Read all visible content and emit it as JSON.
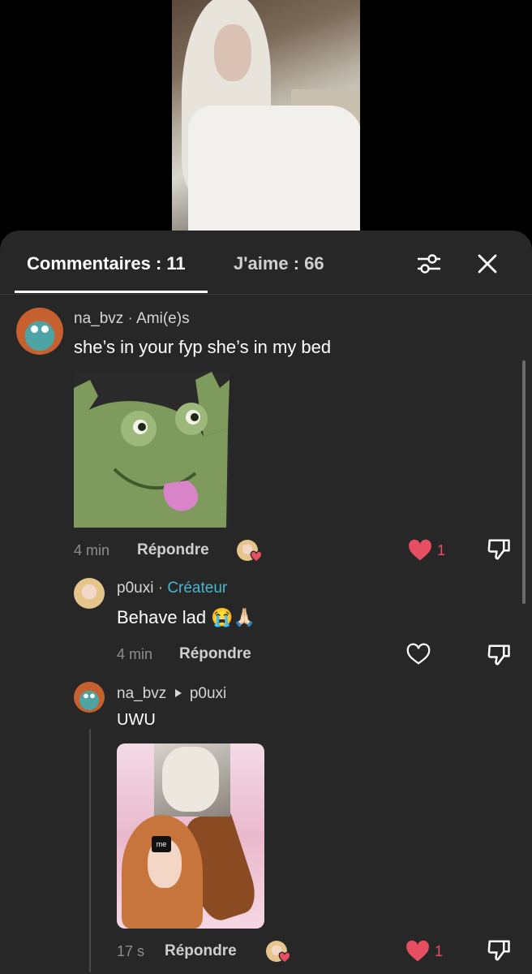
{
  "tabs": {
    "comments": "Commentaires : 11",
    "likes": "J'aime : 66"
  },
  "comments": [
    {
      "user": "na_bvz",
      "badge": "Ami(e)s",
      "text": "she’s in your fyp she’s in my bed",
      "time": "4 min",
      "reply": "Répondre",
      "like_count": "1",
      "liked": true
    },
    {
      "user": "p0uxi",
      "badge": "Créateur",
      "text": "Behave lad 😭🙏🏻",
      "time": "4 min",
      "reply": "Répondre",
      "liked": false
    },
    {
      "user": "na_bvz",
      "reply_to": "p0uxi",
      "text": "UWU",
      "meme_tag": "me",
      "time": "17 s",
      "reply": "Répondre",
      "like_count": "1",
      "liked": true
    }
  ],
  "colors": {
    "accent_creator": "#4bb4cf",
    "like_red": "#e64f62",
    "panel_bg": "#272727"
  },
  "icons": [
    "filter-icon",
    "close-icon",
    "heart-icon",
    "dislike-icon",
    "play-arrow-icon"
  ]
}
